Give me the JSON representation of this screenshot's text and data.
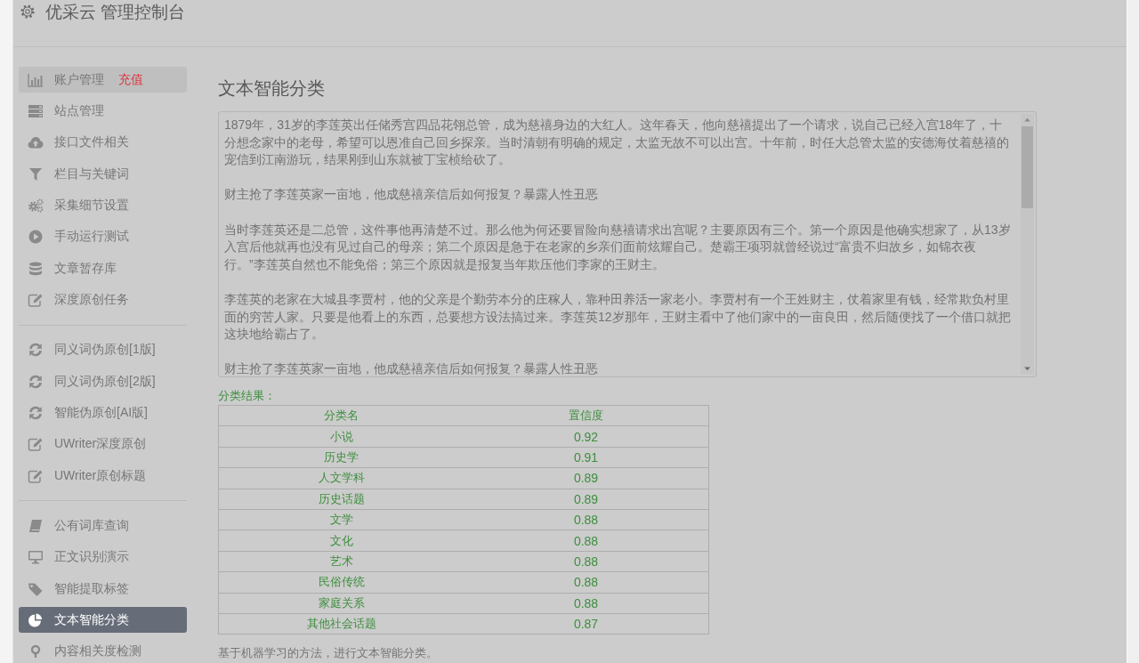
{
  "header": {
    "title": "优采云 管理控制台"
  },
  "sidebar": {
    "groups": [
      {
        "items": [
          {
            "label": "账户管理",
            "badge": "充值",
            "selected": false,
            "highlighted": true
          },
          {
            "label": "站点管理",
            "selected": false,
            "highlighted": false
          },
          {
            "label": "接口文件相关",
            "selected": false,
            "highlighted": false
          },
          {
            "label": "栏目与关键词",
            "selected": false,
            "highlighted": false
          },
          {
            "label": "采集细节设置",
            "selected": false,
            "highlighted": false
          },
          {
            "label": "手动运行测试",
            "selected": false,
            "highlighted": false
          },
          {
            "label": "文章暂存库",
            "selected": false,
            "highlighted": false
          },
          {
            "label": "深度原创任务",
            "selected": false,
            "highlighted": false
          }
        ]
      },
      {
        "items": [
          {
            "label": "同义词伪原创[1版]",
            "selected": false,
            "highlighted": false
          },
          {
            "label": "同义词伪原创[2版]",
            "selected": false,
            "highlighted": false
          },
          {
            "label": "智能伪原创[AI版]",
            "selected": false,
            "highlighted": false
          },
          {
            "label": "UWriter深度原创",
            "selected": false,
            "highlighted": false
          },
          {
            "label": "UWriter原创标题",
            "selected": false,
            "highlighted": false
          }
        ]
      },
      {
        "items": [
          {
            "label": "公有词库查询",
            "selected": false,
            "highlighted": false
          },
          {
            "label": "正文识别演示",
            "selected": false,
            "highlighted": false
          },
          {
            "label": "智能提取标签",
            "selected": false,
            "highlighted": false
          },
          {
            "label": "文本智能分类",
            "selected": true,
            "highlighted": false
          },
          {
            "label": "内容相关度检测",
            "selected": false,
            "highlighted": false
          }
        ]
      }
    ]
  },
  "main": {
    "title": "文本智能分类",
    "article": {
      "paragraphs": [
        "1879年，31岁的李莲英出任储秀宫四品花翎总管，成为慈禧身边的大红人。这年春天，他向慈禧提出了一个请求，说自己已经入宫18年了，十分想念家中的老母，希望可以恩准自己回乡探亲。当时清朝有明确的规定，太监无故不可以出宫。十年前，时任大总管太监的安德海仗着慈禧的宠信到江南游玩，结果刚到山东就被丁宝桢给砍了。",
        "财主抢了李莲英家一亩地，他成慈禧亲信后如何报复？暴露人性丑恶",
        "当时李莲英还是二总管，这件事他再清楚不过。那么他为何还要冒险向慈禧请求出宫呢？主要原因有三个。第一个原因是他确实想家了，从13岁入宫后他就再也没有见过自己的母亲；第二个原因是急于在老家的乡亲们面前炫耀自己。楚霸王项羽就曾经说过“富贵不归故乡，如锦衣夜行。”李莲英自然也不能免俗；第三个原因就是报复当年欺压他们李家的王财主。",
        "李莲英的老家在大城县李贾村，他的父亲是个勤劳本分的庄稼人，靠种田养活一家老小。李贾村有一个王姓财主，仗着家里有钱，经常欺负村里面的穷苦人家。只要是他看上的东西，总要想方设法搞过来。李莲英12岁那年，王财主看中了他们家中的一亩良田，然后随便找了一个借口就把这块地给霸占了。",
        "财主抢了李莲英家一亩地，他成慈禧亲信后如何报复？暴露人性丑恶"
      ]
    },
    "result_label": "分类结果：",
    "table": {
      "columns": [
        "分类名",
        "置信度"
      ],
      "rows": [
        [
          "小说",
          "0.92"
        ],
        [
          "历史学",
          "0.91"
        ],
        [
          "人文学科",
          "0.89"
        ],
        [
          "历史话题",
          "0.89"
        ],
        [
          "文学",
          "0.88"
        ],
        [
          "文化",
          "0.88"
        ],
        [
          "艺术",
          "0.88"
        ],
        [
          "民俗传统",
          "0.88"
        ],
        [
          "家庭关系",
          "0.88"
        ],
        [
          "其他社会话题",
          "0.87"
        ]
      ]
    },
    "note": "基于机器学习的方法，进行文本智能分类。"
  }
}
